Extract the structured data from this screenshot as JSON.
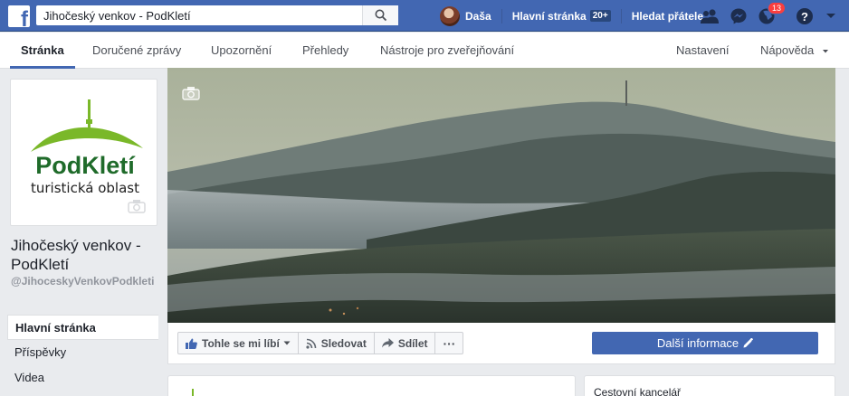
{
  "topbar": {
    "search_value": "Jihočeský venkov - PodKletí",
    "user_name": "Daša",
    "home_label": "Hlavní stránka",
    "home_badge": "20+",
    "find_friends_label": "Hledat přátele",
    "notifications_count": "13",
    "help_label": "?"
  },
  "tabs": {
    "page": "Stránka",
    "inbox": "Doručené zprávy",
    "notifications": "Upozornění",
    "insights": "Přehledy",
    "publishing_tools": "Nástroje pro zveřejňování",
    "settings": "Nastavení",
    "help": "Nápověda"
  },
  "profile": {
    "logo_text": "PodKletí",
    "logo_subtext": "turistická oblast",
    "name": "Jihočeský venkov - PodKletí",
    "handle": "@JihoceskyVenkovPodkleti"
  },
  "leftnav": {
    "home": "Hlavní stránka",
    "posts": "Příspěvky",
    "videos": "Videa"
  },
  "actions": {
    "like": "Tohle se mi líbí",
    "follow": "Sledovat",
    "share": "Sdílet",
    "more_options": "···",
    "more_info": "Další informace"
  },
  "right_card": {
    "category": "Cestovní kancelář"
  },
  "colors": {
    "brand_blue": "#4267b2",
    "logo_green": "#7ab829",
    "logo_dark_green": "#1f6b2a"
  }
}
